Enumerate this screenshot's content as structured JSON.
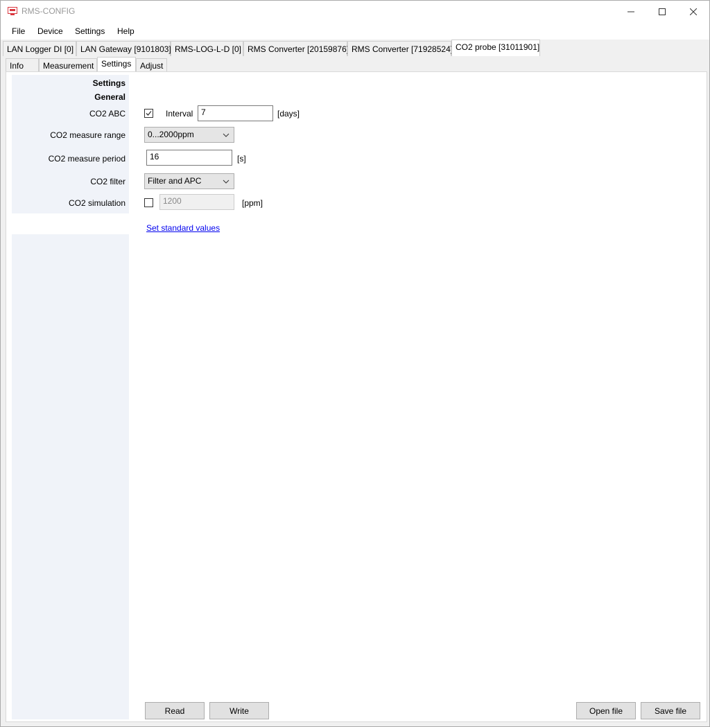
{
  "window": {
    "title": "RMS-CONFIG"
  },
  "menu": {
    "items": [
      "File",
      "Device",
      "Settings",
      "Help"
    ]
  },
  "device_tabs": [
    {
      "label": "LAN Logger DI [0]"
    },
    {
      "label": "LAN Gateway [9101803]"
    },
    {
      "label": "RMS-LOG-L-D [0]"
    },
    {
      "label": "RMS Converter [20159876]"
    },
    {
      "label": "RMS Converter [71928524]"
    },
    {
      "label": "CO2 probe [31011901]",
      "active": true
    }
  ],
  "sub_tabs": [
    {
      "label": "Info"
    },
    {
      "label": "Measurement"
    },
    {
      "label": "Settings",
      "active": true
    },
    {
      "label": "Adjust"
    }
  ],
  "settings": {
    "heading": "Settings",
    "section": "General",
    "co2_abc": {
      "label": "CO2 ABC",
      "checked": true,
      "interval_label": "Interval",
      "interval_value": "7",
      "unit": "[days]"
    },
    "co2_range": {
      "label": "CO2 measure range",
      "selected": "0...2000ppm"
    },
    "co2_period": {
      "label": "CO2 measure period",
      "value": "16",
      "unit": "[s]"
    },
    "co2_filter": {
      "label": "CO2 filter",
      "selected": "Filter and APC"
    },
    "co2_simulation": {
      "label": "CO2 simulation",
      "checked": false,
      "value": "1200",
      "unit": "[ppm]"
    },
    "standard_link": "Set standard values"
  },
  "buttons": {
    "read": "Read",
    "write": "Write",
    "open": "Open file",
    "save": "Save file"
  },
  "colors": {
    "accent_icon": "#d9363e",
    "link": "#0000ee",
    "panel": "#f0f3f9"
  }
}
